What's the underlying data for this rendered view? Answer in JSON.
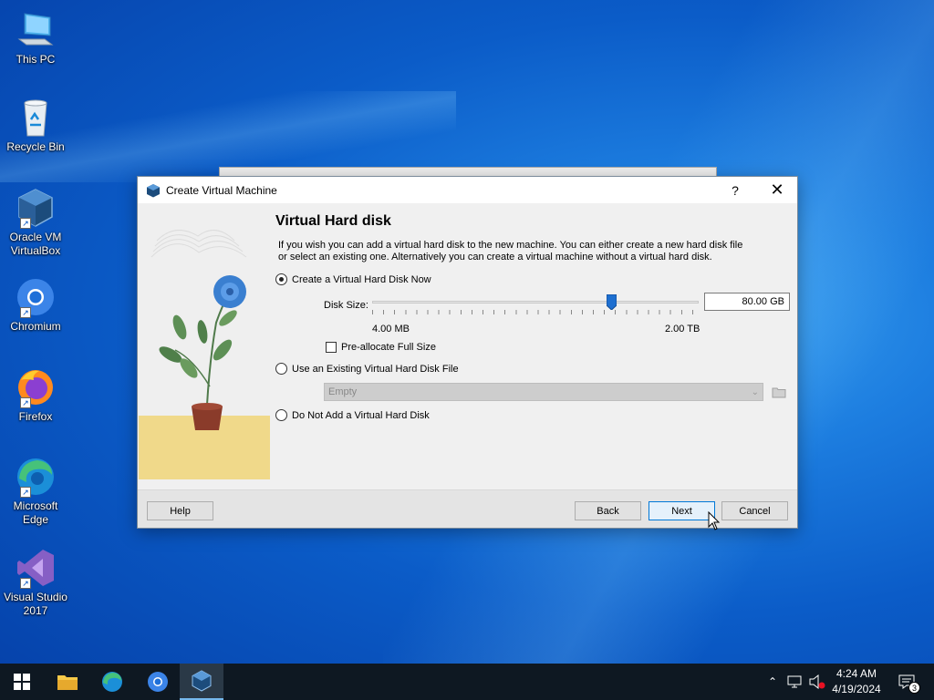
{
  "desktop": {
    "icons": [
      {
        "label": "This PC",
        "icon": "this-pc-icon"
      },
      {
        "label": "Recycle Bin",
        "icon": "recycle-bin-icon"
      },
      {
        "label": "Oracle VM VirtualBox",
        "icon": "virtualbox-icon"
      },
      {
        "label": "Chromium",
        "icon": "chromium-icon"
      },
      {
        "label": "Firefox",
        "icon": "firefox-icon"
      },
      {
        "label": "Microsoft Edge",
        "icon": "edge-icon"
      },
      {
        "label": "Visual Studio 2017",
        "icon": "visual-studio-icon"
      }
    ]
  },
  "dialog": {
    "title": "Create Virtual Machine",
    "help_symbol": "?",
    "close_symbol": "✕",
    "heading": "Virtual Hard disk",
    "description": "If you wish you can add a virtual hard disk to the new machine. You can either create a new hard disk file or select an existing one. Alternatively you can create a virtual machine without a virtual hard disk.",
    "options": {
      "create_now": {
        "label": "Create a Virtual Hard Disk Now",
        "selected": true
      },
      "use_existing": {
        "label": "Use an Existing Virtual Hard Disk File",
        "selected": false
      },
      "do_not_add": {
        "label": "Do Not Add a Virtual Hard Disk",
        "selected": false
      }
    },
    "disk_size": {
      "label": "Disk Size:",
      "value": "80.00 GB",
      "min_label": "4.00 MB",
      "max_label": "2.00 TB",
      "slider_fraction": 0.74
    },
    "preallocate": {
      "label": "Pre-allocate Full Size",
      "checked": false
    },
    "existing_file": {
      "value": "Empty",
      "enabled": false
    },
    "buttons": {
      "help": "Help",
      "back": "Back",
      "next": "Next",
      "cancel": "Cancel"
    }
  },
  "taskbar": {
    "apps": [
      "start-icon",
      "file-explorer-icon",
      "edge-icon",
      "chromium-icon",
      "virtualbox-icon"
    ],
    "active_app": "virtualbox-icon",
    "clock": {
      "time": "4:24 AM",
      "date": "4/19/2024"
    },
    "notification_count": "3"
  },
  "colors": {
    "accent": "#0078d7",
    "desktop_blue": "#0b5cc8",
    "taskbar": "#0e1822"
  }
}
